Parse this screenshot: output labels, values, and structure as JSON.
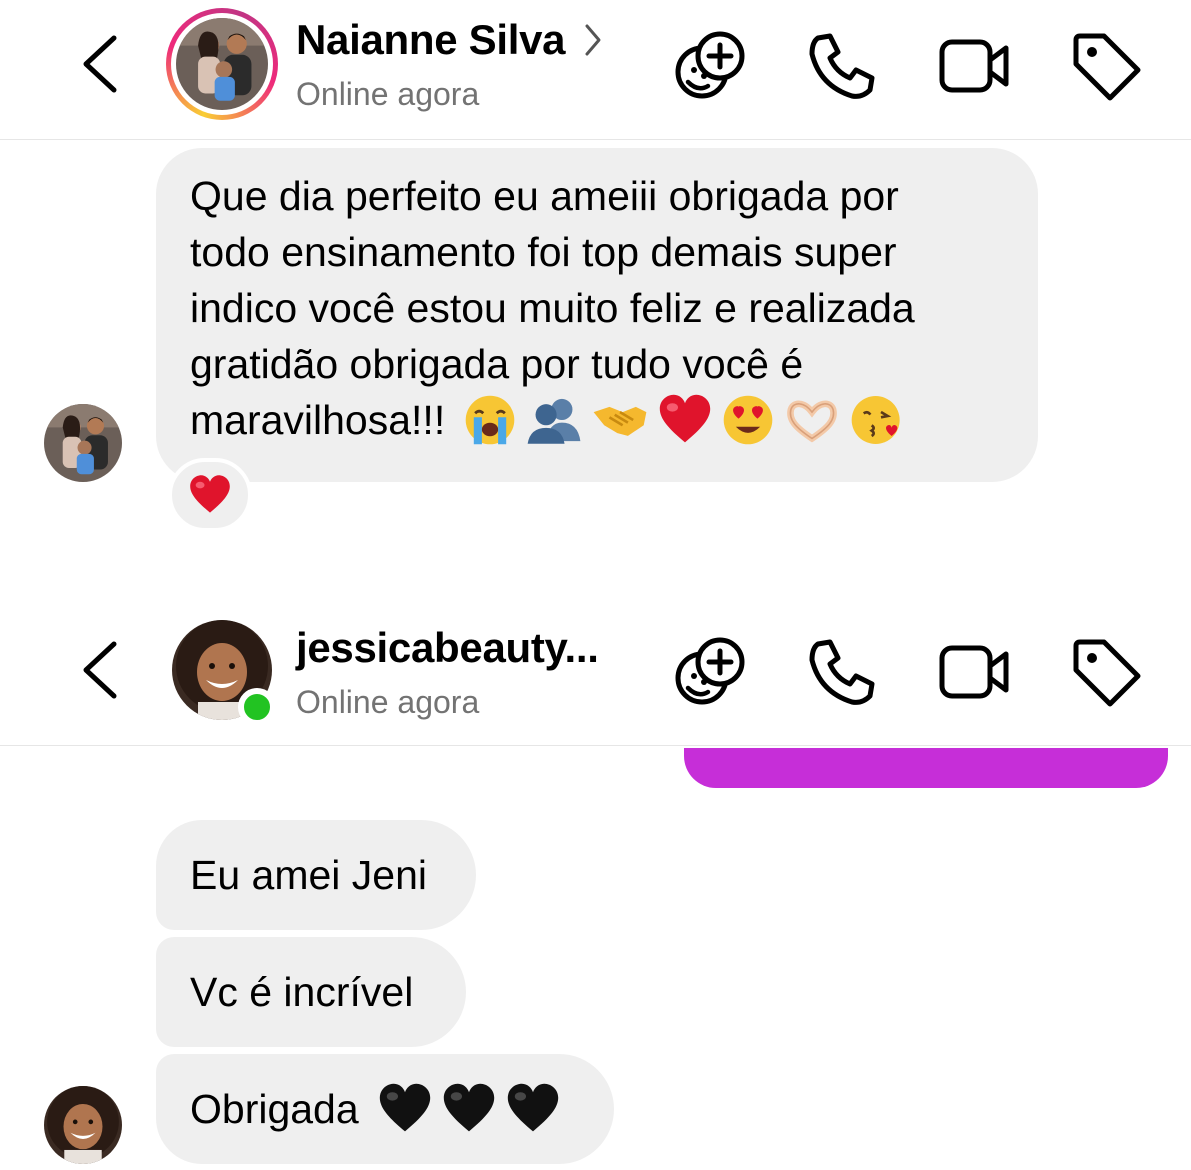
{
  "chat1": {
    "contact_name": "Naianne Silva",
    "status": "Online agora",
    "message": {
      "lines": [
        "Que dia perfeito eu ameiii obrigada por",
        "todo ensinamento foi top demais super",
        "indico você estou muito feliz e realizada",
        "gratidão obrigada por tudo você é",
        "maravilhosa!!!"
      ],
      "emojis": [
        "loudly-crying-face",
        "busts-in-silhouette",
        "handshake",
        "red-heart",
        "heart-eyes-face",
        "heart-hands",
        "face-blowing-kiss"
      ],
      "reaction": "red-heart"
    }
  },
  "chat2": {
    "contact_name": "jessicabeauty...",
    "status": "Online agora",
    "messages": [
      {
        "text": "Eu amei Jeni"
      },
      {
        "text": "Vc é incrível"
      },
      {
        "text": "Obrigada",
        "emojis": [
          "black-heart",
          "black-heart",
          "black-heart"
        ]
      }
    ]
  },
  "header_icons": [
    "add-effect-icon",
    "phone-icon",
    "video-icon",
    "tag-icon"
  ],
  "colors": {
    "bubble_received": "#efefef",
    "bubble_sent": "#c62ed8",
    "status_gray": "#737373",
    "online_green": "#22c322",
    "heart_red": "#e0142c"
  }
}
